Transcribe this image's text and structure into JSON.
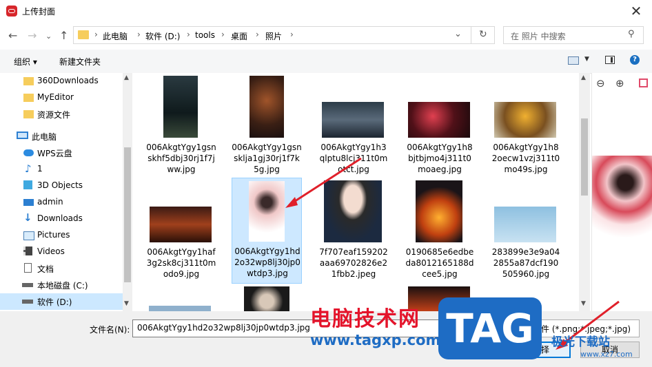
{
  "window": {
    "title": "上传封面"
  },
  "nav": {
    "breadcrumb": [
      "此电脑",
      "软件 (D:)",
      "tools",
      "桌面",
      "照片"
    ],
    "search_placeholder": "在 照片 中搜索"
  },
  "toolbar": {
    "organize": "组织",
    "new_folder": "新建文件夹"
  },
  "sidebar": {
    "items": [
      {
        "label": "360Downloads",
        "icon": "folder-icon"
      },
      {
        "label": "MyEditor",
        "icon": "folder-icon"
      },
      {
        "label": "资源文件",
        "icon": "folder-icon"
      },
      {
        "label": "此电脑",
        "icon": "computer-icon"
      },
      {
        "label": "WPS云盘",
        "icon": "cloud-icon"
      },
      {
        "label": "1",
        "icon": "music-icon"
      },
      {
        "label": "3D Objects",
        "icon": "cube-icon"
      },
      {
        "label": "admin",
        "icon": "desktop-icon"
      },
      {
        "label": "Downloads",
        "icon": "download-icon"
      },
      {
        "label": "Pictures",
        "icon": "pictures-icon"
      },
      {
        "label": "Videos",
        "icon": "videos-icon"
      },
      {
        "label": "文档",
        "icon": "document-icon"
      },
      {
        "label": "本地磁盘 (C:)",
        "icon": "drive-icon"
      },
      {
        "label": "软件 (D:)",
        "icon": "drive-icon"
      }
    ]
  },
  "files": [
    {
      "name": "006AkgtYgy1gsnskhf5dbj30rj1f7jww.jpg",
      "selected": false
    },
    {
      "name": "006AkgtYgy1gsnsklja1gj30rj1f7k5g.jpg",
      "selected": false
    },
    {
      "name": "006AkgtYgy1h3qlptu8lcj311t0motct.jpg",
      "selected": false
    },
    {
      "name": "006AkgtYgy1h8bjtbjmo4j311t0moaeg.jpg",
      "selected": false
    },
    {
      "name": "006AkgtYgy1h82oecw1vzj311t0mo49s.jpg",
      "selected": false
    },
    {
      "name": "006AkgtYgy1haf3g2sk8cj311t0modo9.jpg",
      "selected": false
    },
    {
      "name": "006AkgtYgy1hd2o32wp8lj30jp0wtdp3.jpg",
      "selected": true
    },
    {
      "name": "7f707eaf159202aaa69702826e21fbb2.jpeg",
      "selected": false
    },
    {
      "name": "0190685e6edbeda8012165188dcee5.jpg",
      "selected": false
    },
    {
      "name": "283899e3e9a042855a87dcf190505960.jpg",
      "selected": false
    }
  ],
  "footer": {
    "filename_label": "文件名(N):",
    "filename_value": "006AkgtYgy1hd2o32wp8lj30jp0wtdp3.jpg",
    "filter_value": "图片文件 (*.png;*.jpeg;*.jpg)",
    "open_label": "选择",
    "cancel_label": "取消"
  },
  "watermark": {
    "title": "电脑技术网",
    "url": "www.tagxp.com",
    "badge": "TAG",
    "site": "极光下载站",
    "site_url": "www.xz7.com"
  },
  "colors": {
    "accent": "#0078d7",
    "selection": "#cde8ff",
    "watermark_red": "#e4142b",
    "watermark_blue": "#1e6cc4"
  }
}
